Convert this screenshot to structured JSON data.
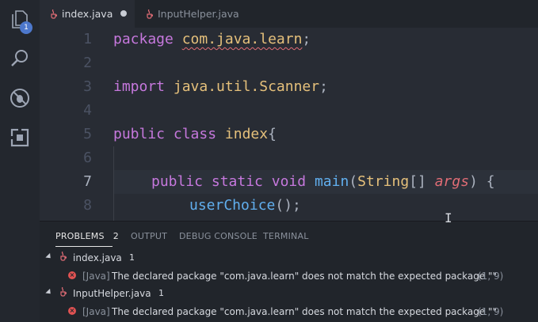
{
  "activity_bar": {
    "explorer_badge": "1",
    "icons": [
      "files-icon",
      "search-icon",
      "debug-icon",
      "extensions-icon"
    ]
  },
  "tabs": [
    {
      "label": "index.java",
      "modified": true,
      "active": true
    },
    {
      "label": "InputHelper.java",
      "modified": false,
      "active": false
    }
  ],
  "editor": {
    "line_numbers": [
      "1",
      "2",
      "3",
      "4",
      "5",
      "6",
      "7",
      "8"
    ],
    "lines": {
      "l1_kw": "package",
      "l1_pkg": "com.java.learn",
      "l1_end": ";",
      "l3_kw": "import",
      "l3_pkg": "java.util.Scanner",
      "l3_end": ";",
      "l5_kw1": "public",
      "l5_kw2": "class",
      "l5_cls": "index",
      "l5_end": "{",
      "l7_kw1": "public",
      "l7_kw2": "static",
      "l7_kw3": "void",
      "l7_fn": "main",
      "l7_open": "(",
      "l7_type": "String",
      "l7_arr": "[]",
      "l7_param": "args",
      "l7_close": ") {",
      "l8_fn": "userChoice",
      "l8_end": "();"
    }
  },
  "panel": {
    "tabs": {
      "problems": "PROBLEMS",
      "problems_count": "2",
      "output": "OUTPUT",
      "debug_console": "DEBUG CONSOLE",
      "terminal": "TERMINAL"
    },
    "groups": [
      {
        "file": "index.java",
        "count": "1",
        "problems": [
          {
            "source": "[Java]",
            "message": "The declared package \"com.java.learn\" does not match the expected package \"\"",
            "position": "(1, 9)"
          }
        ]
      },
      {
        "file": "InputHelper.java",
        "count": "1",
        "problems": [
          {
            "source": "[Java]",
            "message": "The declared package \"com.java.learn\" does not match the expected package \"\"",
            "position": "(1, 9)"
          }
        ]
      }
    ]
  },
  "colors": {
    "error": "#e05252",
    "keyword": "#c678dd",
    "class": "#e5c07b",
    "function": "#61afef",
    "param": "#e06c75"
  }
}
